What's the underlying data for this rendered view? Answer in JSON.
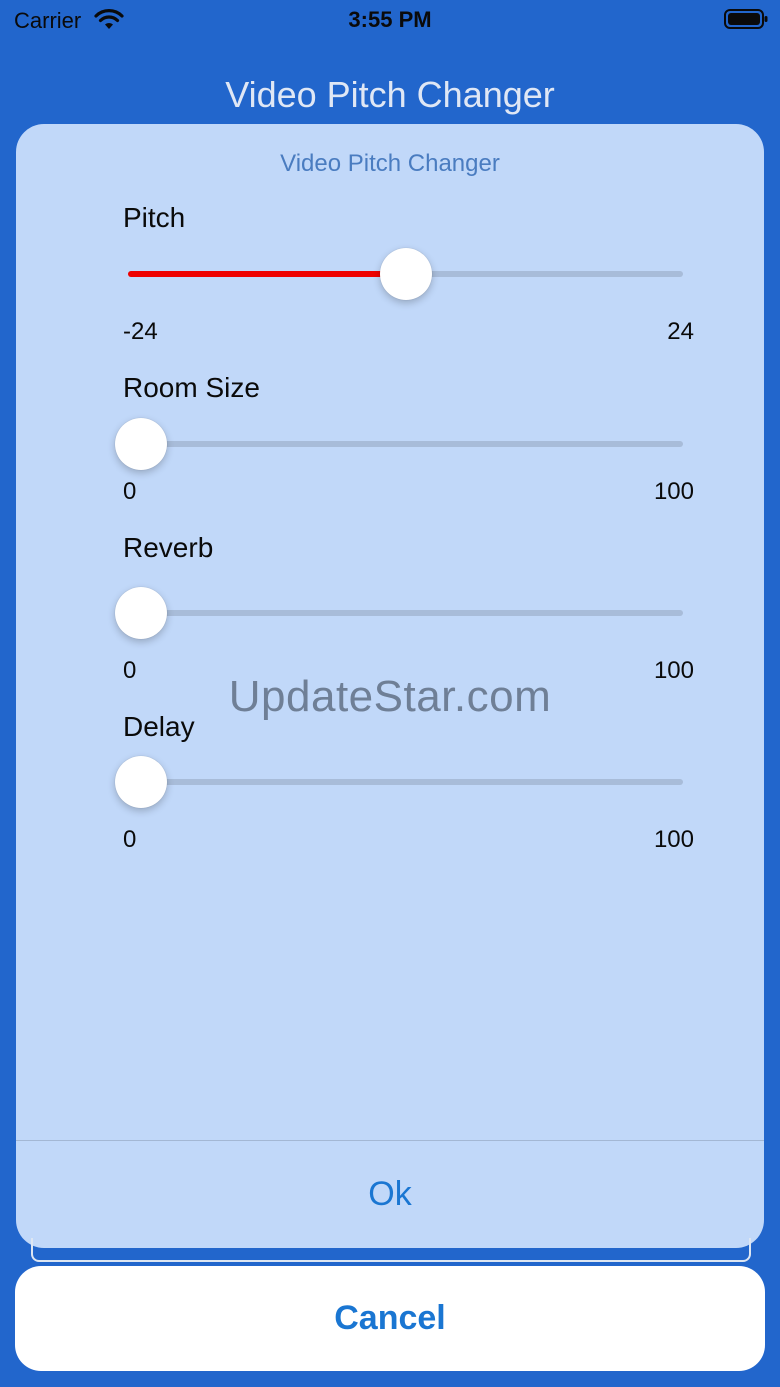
{
  "status_bar": {
    "carrier": "Carrier",
    "time": "3:55 PM",
    "wifi_icon": "wifi-icon",
    "battery_icon": "battery-icon"
  },
  "app_title": "Video Pitch Changer",
  "sheet": {
    "title": "Video Pitch Changer",
    "params": [
      {
        "label": "Pitch",
        "min": "-24",
        "max": "24",
        "value": 0,
        "range": [
          -24,
          24
        ]
      },
      {
        "label": "Room Size",
        "min": "0",
        "max": "100",
        "value": 0,
        "range": [
          0,
          100
        ]
      },
      {
        "label": "Reverb",
        "min": "0",
        "max": "100",
        "value": 0,
        "range": [
          0,
          100
        ]
      },
      {
        "label": "Delay",
        "min": "0",
        "max": "100",
        "value": 0,
        "range": [
          0,
          100
        ]
      }
    ],
    "ok_label": "Ok"
  },
  "watermark": "UpdateStar.com",
  "cancel_label": "Cancel",
  "colors": {
    "background": "#2266cc",
    "sheet": "#c1d8f9",
    "accent": "#1a76d2",
    "pitch_fill": "#ee0000"
  }
}
